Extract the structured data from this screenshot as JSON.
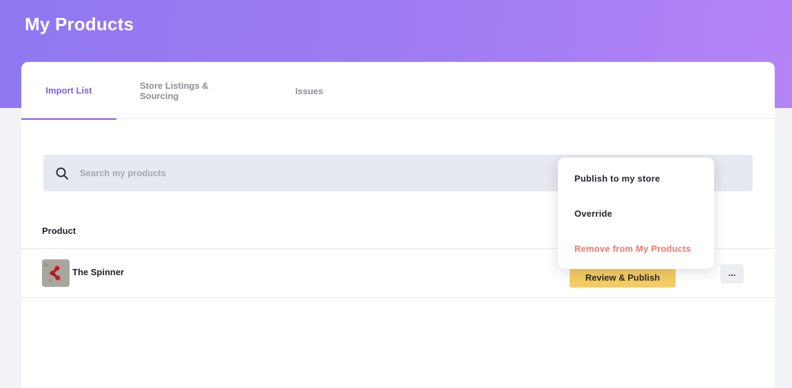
{
  "header": {
    "title": "My Products"
  },
  "tabs": [
    {
      "label": "Import List",
      "active": true
    },
    {
      "label": "Store Listings & Sourcing",
      "active": false
    },
    {
      "label": "Issues",
      "active": false
    }
  ],
  "search": {
    "placeholder": "Search my products",
    "icon": "search-icon"
  },
  "table": {
    "columns": [
      "Product"
    ],
    "rows": [
      {
        "name": "The Spinner",
        "thumbnail": "fidget-spinner-image",
        "primary_action": "Review & Publish",
        "more_label": "..."
      }
    ]
  },
  "dropdown_menu": {
    "items": [
      {
        "label": "Publish to my store",
        "style": "default"
      },
      {
        "label": "Override",
        "style": "default"
      },
      {
        "label": "Remove from My Products",
        "style": "danger"
      }
    ]
  },
  "colors": {
    "accent": "#7c5ce6",
    "header_gradient_start": "#8f77f1",
    "header_gradient_end": "#b483f6",
    "publish_button": "#f4cc63",
    "danger": "#f1766a"
  }
}
